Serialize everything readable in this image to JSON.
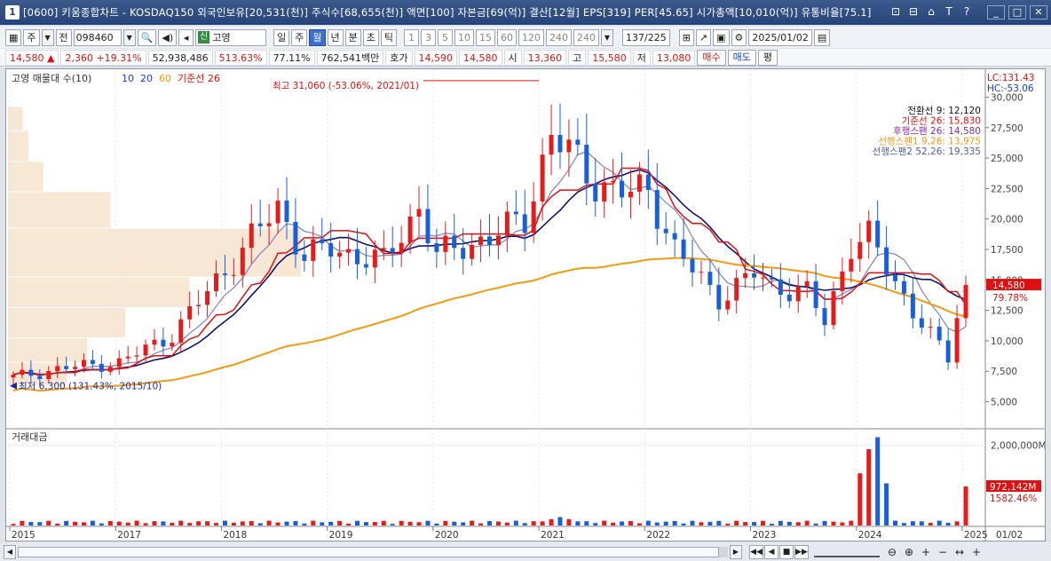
{
  "window": {
    "title": "[0600] 키움종합차트 - KOSDAQ150 외국인보유[20,531(천)] 주식수[68,655(천)] 액면[100] 자본금[69(억)] 결산[12월] EPS[319] PER[45.65] 시가총액[10,010(억)] 유통비율[75.1]",
    "icon_label": "1",
    "tools": [
      "⊡",
      "⊟",
      "⌂",
      "T",
      "?"
    ],
    "win_buttons": [
      "_",
      "□",
      "✕"
    ]
  },
  "toolbar": {
    "mode_1": "주",
    "mode_2": "전",
    "code": "098460",
    "badge": "신",
    "stock_name": "고영",
    "periods": [
      "일",
      "주",
      "월",
      "년",
      "분",
      "초",
      "틱"
    ],
    "active_period": "월",
    "minutes": [
      "1",
      "3",
      "5",
      "10",
      "15",
      "60",
      "120",
      "240"
    ],
    "minute_select": "240",
    "count": "137",
    "total": "/225",
    "date": "2025/01/02"
  },
  "quote": {
    "price": "14,580",
    "change_arrow": "▲",
    "change": "2,360",
    "change_pct": "+19.31%",
    "volume": "52,938,486",
    "vol_ratio": "513.63%",
    "turnover_ratio": "77.11%",
    "amount": "762,541백만",
    "bid_label": "호가",
    "ask1": "14,590",
    "bid1": "14,580",
    "open_label": "시",
    "open": "13,360",
    "high_label": "고",
    "high": "15,580",
    "low_label": "저",
    "low": "13,080",
    "buy_label": "매수",
    "sell_label": "매도",
    "even_label": "평"
  },
  "chart_data": {
    "type": "candlestick",
    "title": "고영 매물대 수(10)",
    "ma_labels": [
      {
        "name": "10",
        "color": "#1a3cc8"
      },
      {
        "name": "20",
        "color": "#1a3cc8"
      },
      {
        "name": "60",
        "color": "#f39a10"
      },
      {
        "name": "기준선 26",
        "color": "#e01010"
      }
    ],
    "y_axis": {
      "ticks": [
        "30,000",
        "27,500",
        "25,000",
        "22,500",
        "20,000",
        "17,500",
        "15,000",
        "12,500",
        "10,000",
        "7,500",
        "5,000"
      ],
      "tick_values": [
        30000,
        27500,
        25000,
        22500,
        20000,
        17500,
        15000,
        12500,
        10000,
        7500,
        5000
      ],
      "ylim": [
        3000,
        32000
      ]
    },
    "x_axis": {
      "ticks": [
        "2015",
        "2017",
        "2018",
        "2019",
        "2020",
        "2021",
        "2022",
        "2023",
        "2024",
        "2025"
      ],
      "tick_months": [
        0,
        12,
        24,
        36,
        48,
        60,
        72,
        84,
        96,
        108
      ],
      "end_label": "01/02"
    },
    "high_annotation": "최고 31,060 (-53.06%, 2021/01)",
    "low_annotation": "최저 6,300 (131.43%, 2015/10)",
    "corner": {
      "lc": "LC:131.43",
      "hc": "HC:-53.06"
    },
    "ichimoku_legend": [
      {
        "text": "전환선 9: 12,120",
        "color": "#111111"
      },
      {
        "text": "기준선 26: 15,830",
        "color": "#e01010"
      },
      {
        "text": "후행스팬 26: 14,580",
        "color": "#8a2aa0"
      },
      {
        "text": "선행스팬1 9,26: 13,975",
        "color": "#f39a10"
      },
      {
        "text": "선행스팬2 52,26: 19,335",
        "color": "#5060a0"
      }
    ],
    "price_tag": "14,580",
    "price_tag_pct": "79.78%",
    "last_close": 14580,
    "anchors_close": [
      [
        0,
        7000
      ],
      [
        6,
        7800
      ],
      [
        12,
        8200
      ],
      [
        18,
        10500
      ],
      [
        24,
        15800
      ],
      [
        30,
        21000
      ],
      [
        33,
        17000
      ],
      [
        36,
        17500
      ],
      [
        42,
        16500
      ],
      [
        46,
        21000
      ],
      [
        48,
        17000
      ],
      [
        54,
        18500
      ],
      [
        58,
        20000
      ],
      [
        61,
        27000
      ],
      [
        66,
        23000
      ],
      [
        70,
        22000
      ],
      [
        72,
        22500
      ],
      [
        75,
        17500
      ],
      [
        78,
        15000
      ],
      [
        80,
        13500
      ],
      [
        84,
        15500
      ],
      [
        86,
        14500
      ],
      [
        90,
        14000
      ],
      [
        92,
        11500
      ],
      [
        95,
        18000
      ],
      [
        97,
        18500
      ],
      [
        99,
        16000
      ],
      [
        102,
        12500
      ],
      [
        104,
        10500
      ],
      [
        106,
        8500
      ],
      [
        107,
        12220
      ],
      [
        108,
        14580
      ]
    ],
    "volume_profile": [
      {
        "low": 27200,
        "high": 29200,
        "share": 0.05
      },
      {
        "low": 24700,
        "high": 27200,
        "share": 0.07
      },
      {
        "low": 22200,
        "high": 24700,
        "share": 0.12
      },
      {
        "low": 19200,
        "high": 22200,
        "share": 0.35
      },
      {
        "low": 15200,
        "high": 19200,
        "share": 1.0
      },
      {
        "low": 12700,
        "high": 15200,
        "share": 0.62
      },
      {
        "low": 10200,
        "high": 12700,
        "share": 0.4
      },
      {
        "low": 8200,
        "high": 10200,
        "share": 0.27
      },
      {
        "low": 6300,
        "high": 8200,
        "share": 0.2
      }
    ],
    "sub_panel": {
      "title": "거래대금",
      "y_tick": "2,000,000M",
      "y_tick_value": 2000000,
      "ylim": [
        0,
        2300000
      ],
      "tag": "972,142M",
      "tag_pct": "1582.46%",
      "spikes": [
        [
          96,
          1300000
        ],
        [
          97,
          1900000
        ],
        [
          98,
          2200000
        ],
        [
          99,
          1050000
        ],
        [
          108,
          972142
        ]
      ]
    }
  },
  "bottom": {
    "nav": [
      "◀◀",
      "◀",
      "■",
      "▶▶"
    ],
    "zoom": [
      "⊖",
      "⊕",
      "+",
      "−",
      "↔",
      "+"
    ]
  }
}
